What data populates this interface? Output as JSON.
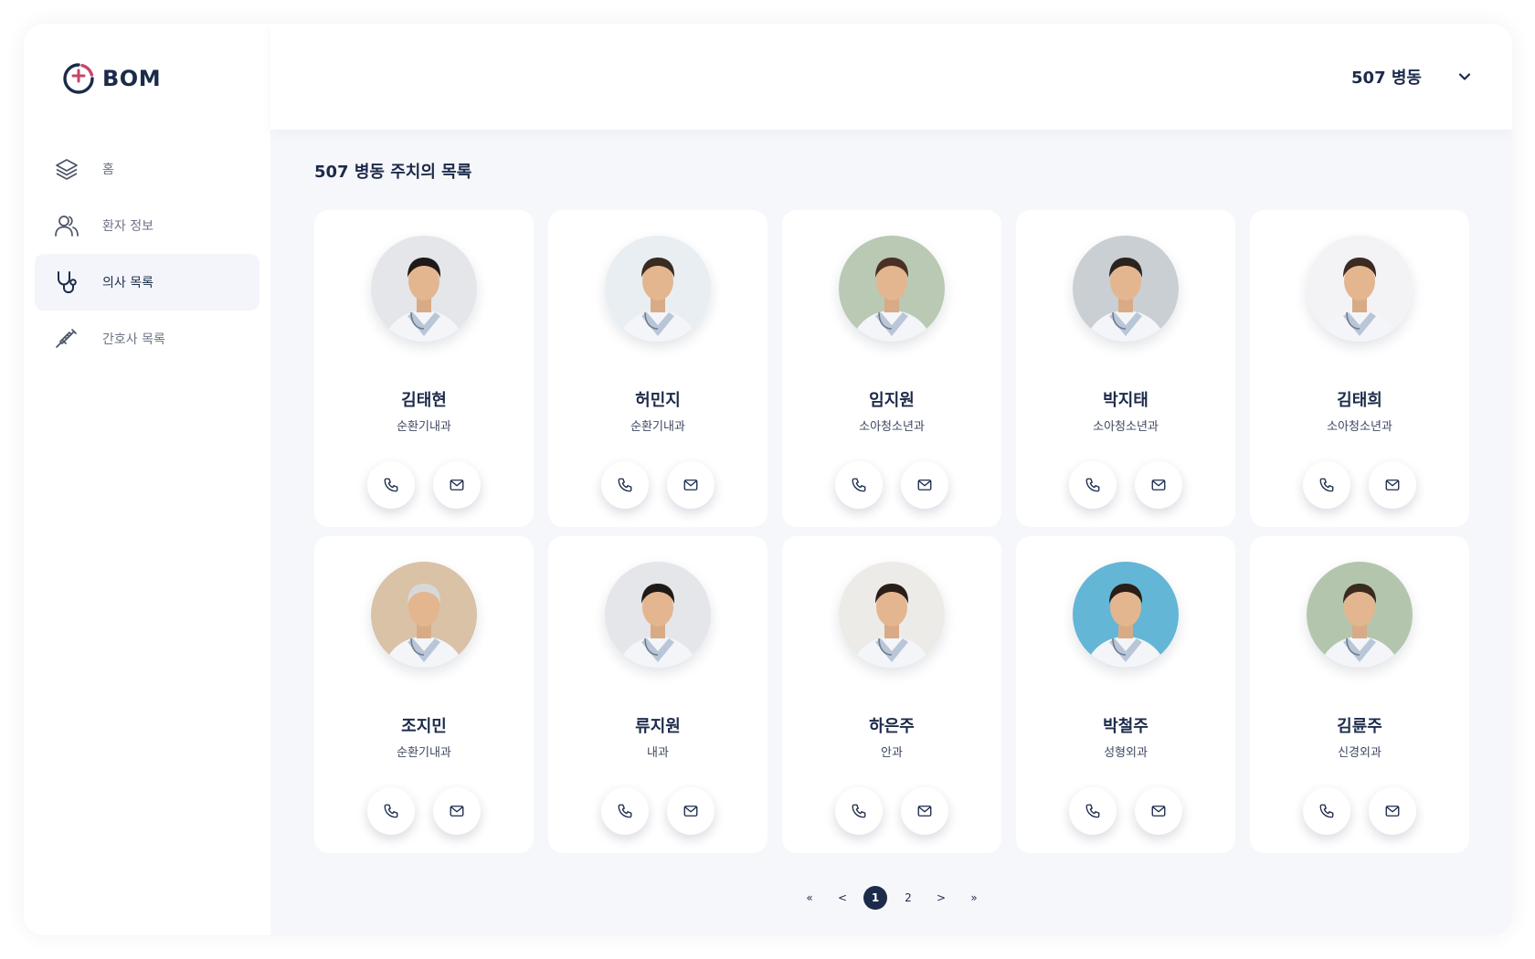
{
  "brand": {
    "name": "BOM",
    "accent": "#1c2b4a",
    "cross_color": "#c8456a"
  },
  "sidebar": {
    "items": [
      {
        "label": "홈",
        "icon": "layers-icon",
        "active": false
      },
      {
        "label": "환자 정보",
        "icon": "users-icon",
        "active": false
      },
      {
        "label": "의사 목록",
        "icon": "stethoscope-icon",
        "active": true
      },
      {
        "label": "간호사 목록",
        "icon": "syringe-icon",
        "active": false
      }
    ]
  },
  "header": {
    "ward": "507 병동",
    "dropdown_icon": "chevron-down-icon"
  },
  "main": {
    "title": "507 병동 주치의 목록",
    "doctors": [
      {
        "name": "김태현",
        "dept": "순환기내과"
      },
      {
        "name": "허민지",
        "dept": "순환기내과"
      },
      {
        "name": "임지원",
        "dept": "소아청소년과"
      },
      {
        "name": "박지태",
        "dept": "소아청소년과"
      },
      {
        "name": "김태희",
        "dept": "소아청소년과"
      },
      {
        "name": "조지민",
        "dept": "순환기내과"
      },
      {
        "name": "류지원",
        "dept": "내과"
      },
      {
        "name": "하은주",
        "dept": "안과"
      },
      {
        "name": "박철주",
        "dept": "성형외과"
      },
      {
        "name": "김륜주",
        "dept": "신경외과"
      }
    ]
  },
  "pagination": {
    "first": "«",
    "prev": "<",
    "pages": [
      "1",
      "2"
    ],
    "current": "1",
    "next": ">",
    "last": "»"
  }
}
